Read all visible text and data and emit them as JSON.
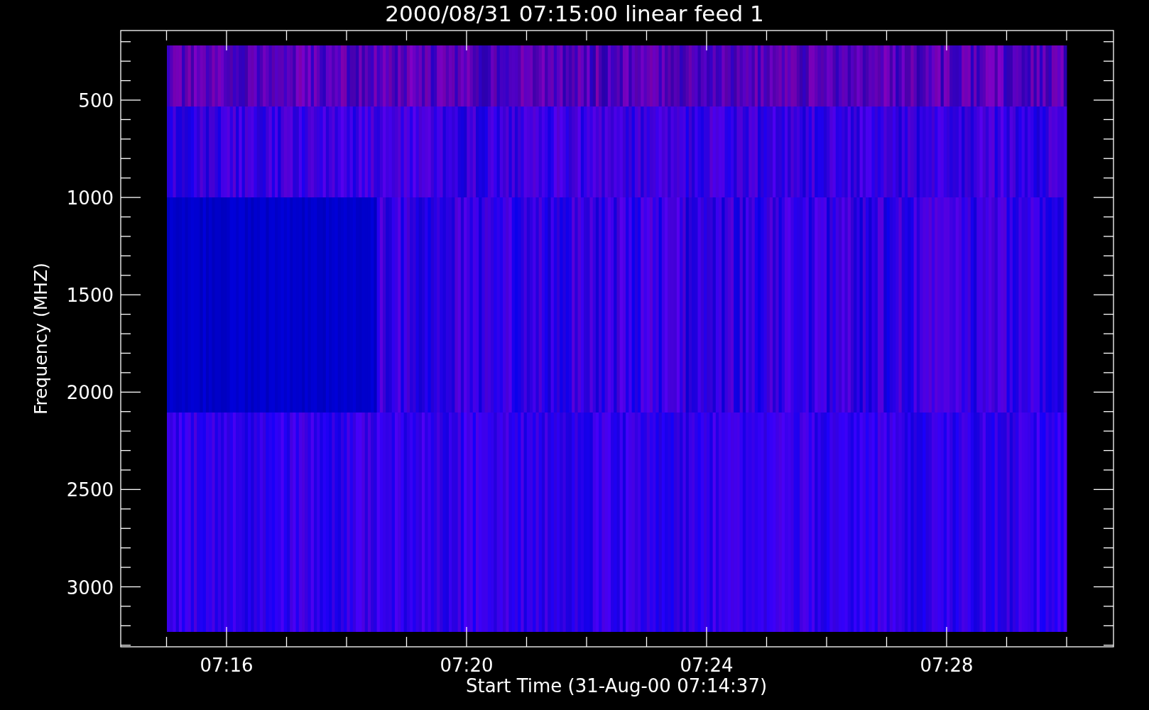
{
  "plot": {
    "title": "2000/08/31 07:15:00 linear feed 1",
    "xlabel": "Start Time (31-Aug-00 07:14:37)",
    "ylabel": "Frequency (MHZ)",
    "yticks": [
      "500",
      "1000",
      "1500",
      "2000",
      "2500",
      "3000"
    ],
    "xticks": [
      "07:16",
      "07:20",
      "07:24",
      "07:28"
    ]
  }
}
